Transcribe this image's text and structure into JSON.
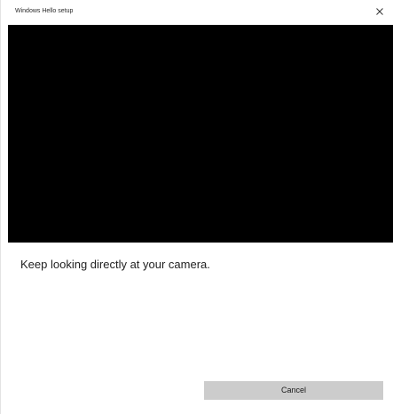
{
  "window": {
    "title": "Windows Hello setup",
    "close_icon": "close-icon"
  },
  "main": {
    "instruction": "Keep looking directly at your camera."
  },
  "footer": {
    "cancel_label": "Cancel"
  },
  "colors": {
    "camera_background": "#000000",
    "button_background": "#cccccc",
    "window_background": "#ffffff"
  }
}
